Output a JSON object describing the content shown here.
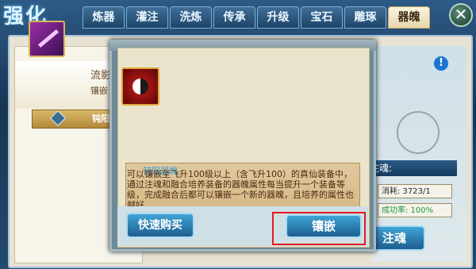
{
  "title": "强化",
  "tabs": [
    {
      "label": "炼器"
    },
    {
      "label": "灌注"
    },
    {
      "label": "洗炼"
    },
    {
      "label": "传承"
    },
    {
      "label": "升级"
    },
    {
      "label": "宝石"
    },
    {
      "label": "雕琢"
    },
    {
      "label": "器魄"
    }
  ],
  "close": {
    "label": "✕"
  },
  "left_panel": {
    "equip_name": "流影",
    "equip_sub": "镶嵌",
    "soul_bar_label": "钝阳"
  },
  "right_panel": {
    "info_label": "!",
    "seal": "",
    "inject_title": "注魂:",
    "cost": "消耗: 3723/1",
    "rate": "成功率: 100%",
    "inject_button": "注魂"
  },
  "dialog": {
    "desc_title": "钝阳器魄",
    "desc_text": "可以镶嵌至飞升100级以上（含飞升100）的真仙装备中，通过注魂和融合培养装备的器魄属性每当提升一个装备等级，完成融合后都可以镶嵌一个新的器魄，且培养的属性也越好",
    "quick_buy": "快速购买",
    "embed": "镶嵌"
  },
  "colors": {
    "accent": "#1d5f8f",
    "highlight": "#e01b1b",
    "success": "#1b9a3c"
  }
}
